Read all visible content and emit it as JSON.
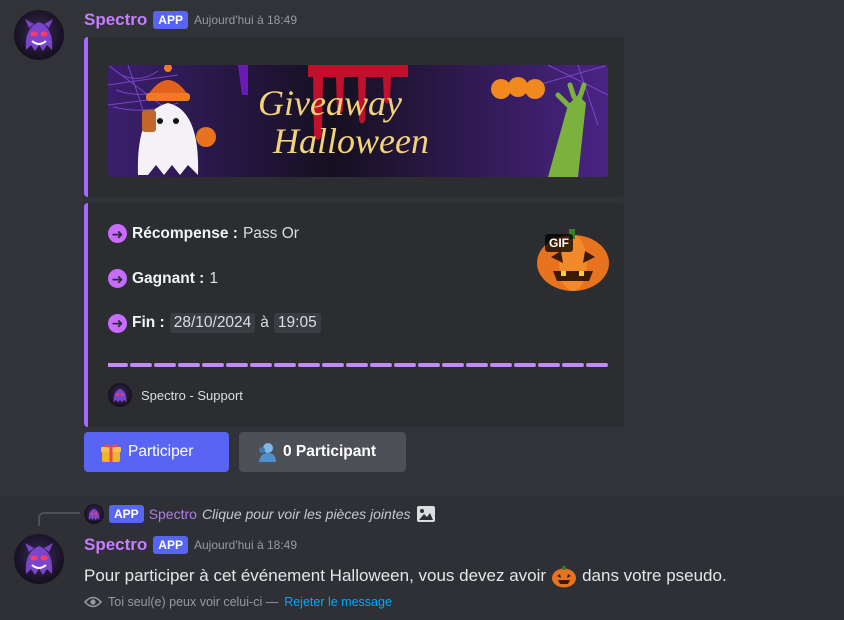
{
  "message1": {
    "username": "Spectro",
    "badge": "APP",
    "timestamp": "Aujourd'hui à 18:49",
    "banner": {
      "title_line1": "Giveaway",
      "title_line2": "Halloween",
      "colors": {
        "bg": "#1a1030",
        "title": "#f3d27a",
        "drip": "#c0102b",
        "web": "#7a3bd8"
      }
    },
    "embed": {
      "accent": "#a56bff",
      "fields": [
        {
          "name": "Récompense :",
          "value": "Pass Or"
        },
        {
          "name": "Gagnant :",
          "value": "1"
        },
        {
          "name": "Fin :",
          "date": "28/10/2024",
          "connector": "à",
          "time": "19:05"
        }
      ],
      "gif_label": "GIF",
      "footer_text": "Spectro - Support"
    },
    "buttons": {
      "participate": {
        "icon": "gift-icon",
        "label": "Participer"
      },
      "participants": {
        "icon": "user-icon",
        "label": "0 Participant"
      }
    }
  },
  "message2": {
    "reply": {
      "badge": "APP",
      "username": "Spectro",
      "text": "Clique pour voir les pièces jointes",
      "icon": "image-icon"
    },
    "username": "Spectro",
    "badge": "APP",
    "timestamp": "Aujourd'hui à 18:49",
    "text_before": "Pour participer à cet événement Halloween, vous devez avoir",
    "emoji": "jack-o-lantern",
    "text_after": "dans votre pseudo.",
    "ephemeral_note": "Toi seul(e) peux voir celui-ci —",
    "dismiss_link": "Rejeter le message"
  }
}
